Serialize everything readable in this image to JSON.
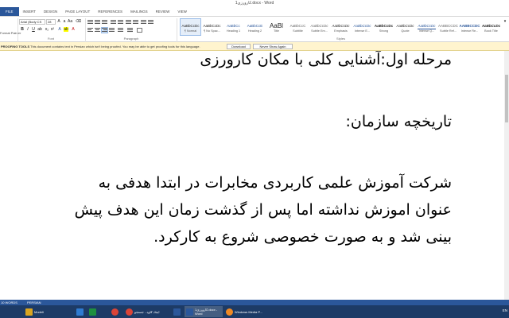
{
  "window": {
    "title": "کارورزی1.docx - Word"
  },
  "ribbon_tabs": [
    "FILE",
    "INSERT",
    "DESIGN",
    "PAGE LAYOUT",
    "REFERENCES",
    "MAILINGS",
    "REVIEW",
    "VIEW"
  ],
  "ribbon": {
    "clipboard": {
      "format_painter": "Format Painter"
    },
    "font": {
      "name": "Arial (Body CS",
      "size": "28",
      "group_label": "Font"
    },
    "paragraph": {
      "group_label": "Paragraph"
    },
    "styles": {
      "group_label": "Styles",
      "items": [
        {
          "preview": "AaBbCcDc",
          "name": "¶ Normal"
        },
        {
          "preview": "AaBbCcDc",
          "name": "¶ No Spac..."
        },
        {
          "preview": "AaBbCc",
          "name": "Heading 1"
        },
        {
          "preview": "AaBbCcE",
          "name": "Heading 2"
        },
        {
          "preview": "AaBl",
          "name": "Title"
        },
        {
          "preview": "AaBbCcC",
          "name": "Subtitle"
        },
        {
          "preview": "AaBbCcDc",
          "name": "Subtle Em..."
        },
        {
          "preview": "AaBbCcDc",
          "name": "Emphasis"
        },
        {
          "preview": "AaBbCcDc",
          "name": "Intense E..."
        },
        {
          "preview": "AaBbCcDc",
          "name": "Strong"
        },
        {
          "preview": "AaBbCcDc",
          "name": "Quote"
        },
        {
          "preview": "AaBbCcDc",
          "name": "Intense Q..."
        },
        {
          "preview": "AABBCCDC",
          "name": "Subtle Ref..."
        },
        {
          "preview": "AABBCCDC",
          "name": "Intense Re..."
        },
        {
          "preview": "AaBbCcDc",
          "name": "Book Title"
        }
      ]
    }
  },
  "infobar": {
    "title": "PROOFING TOOLS",
    "message": "This document contains text in Persian which isn't being proofed. You may be able to get proofing tools for this language.",
    "download_label": "Download",
    "never_label": "Never Show Again"
  },
  "document": {
    "heading1": "مرحله اول:آشنایی کلی با مکان کارورزی",
    "heading2": "تاریخچه سازمان:",
    "body_lines": [
      "شرکت آموزش علمی  کاربردی مخابرات در ابتدا هدفی به",
      "عنوان اموزش نداشته اما پس از گذشت زمان این هدف پیش",
      "بینی شد و به صورت خصوصی شروع به کارکرد."
    ]
  },
  "statusbar": {
    "words": "10 WORDS",
    "language": "PERSIAN"
  },
  "taskbar": {
    "items": [
      {
        "label": "Modeli",
        "color": "#d9a521"
      },
      {
        "label": "",
        "color": "#2f7bd1"
      },
      {
        "label": "",
        "color": "#1e8f3f"
      },
      {
        "label": "",
        "color": "#db4437"
      },
      {
        "label": "ایجاد کاوه - جستجو",
        "color": "#db4437"
      },
      {
        "label": "",
        "color": "#2b579a"
      },
      {
        "label": "کارورزی1.docx - Word",
        "color": "#2b579a"
      },
      {
        "label": "Windows Media P...",
        "color": "#f08a24"
      }
    ],
    "tray_lang": "EN"
  }
}
